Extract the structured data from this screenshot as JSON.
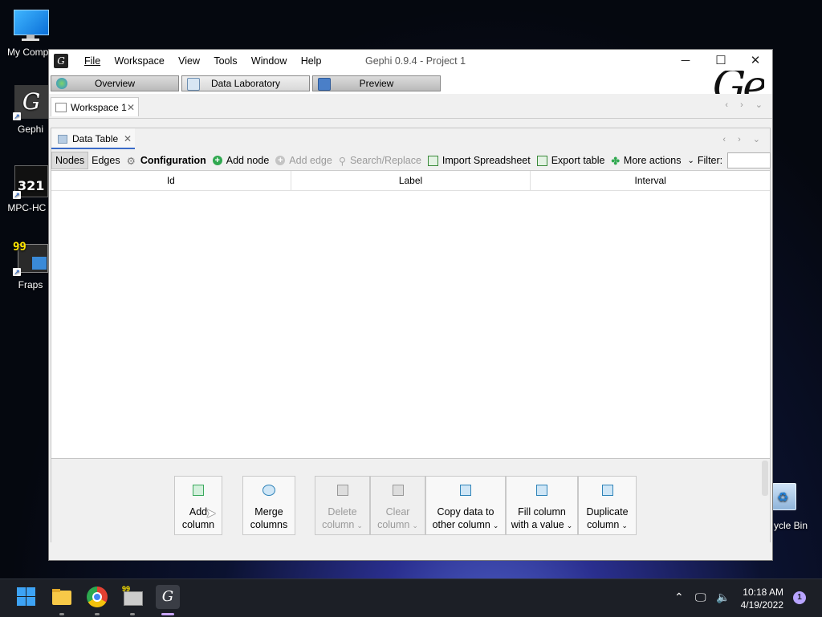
{
  "desktop": {
    "icons": [
      {
        "label": "My Compu"
      },
      {
        "label": "Gephi"
      },
      {
        "label": "MPC-HC x"
      },
      {
        "label": "Fraps"
      }
    ],
    "recycle_bin_label": "ycle Bin"
  },
  "window": {
    "title": "Gephi 0.9.4 - Project 1",
    "menu": [
      "File",
      "Workspace",
      "View",
      "Tools",
      "Window",
      "Help"
    ],
    "perspectives": [
      "Overview",
      "Data Laboratory",
      "Preview"
    ],
    "workspace_tab": "Workspace 1",
    "data_table_tab": "Data Table",
    "toolbar": {
      "nodes": "Nodes",
      "edges": "Edges",
      "configuration": "Configuration",
      "add_node": "Add node",
      "add_edge": "Add edge",
      "search_replace": "Search/Replace",
      "import_spreadsheet": "Import Spreadsheet",
      "export_table": "Export table",
      "more_actions": "More actions",
      "filter_label": "Filter:",
      "filter_value": ""
    },
    "columns": [
      "Id",
      "Label",
      "Interval"
    ],
    "column_actions": [
      {
        "line1": "Add",
        "line2": "column"
      },
      {
        "line1": "Merge",
        "line2": "columns"
      },
      {
        "line1": "Delete",
        "line2": "column"
      },
      {
        "line1": "Clear",
        "line2": "column"
      },
      {
        "line1": "Copy data to",
        "line2": "other column"
      },
      {
        "line1": "Fill column",
        "line2": "with a value"
      },
      {
        "line1": "Duplicate",
        "line2": "column"
      }
    ]
  },
  "taskbar": {
    "time": "10:18 AM",
    "date": "4/19/2022",
    "notifications": "1"
  }
}
